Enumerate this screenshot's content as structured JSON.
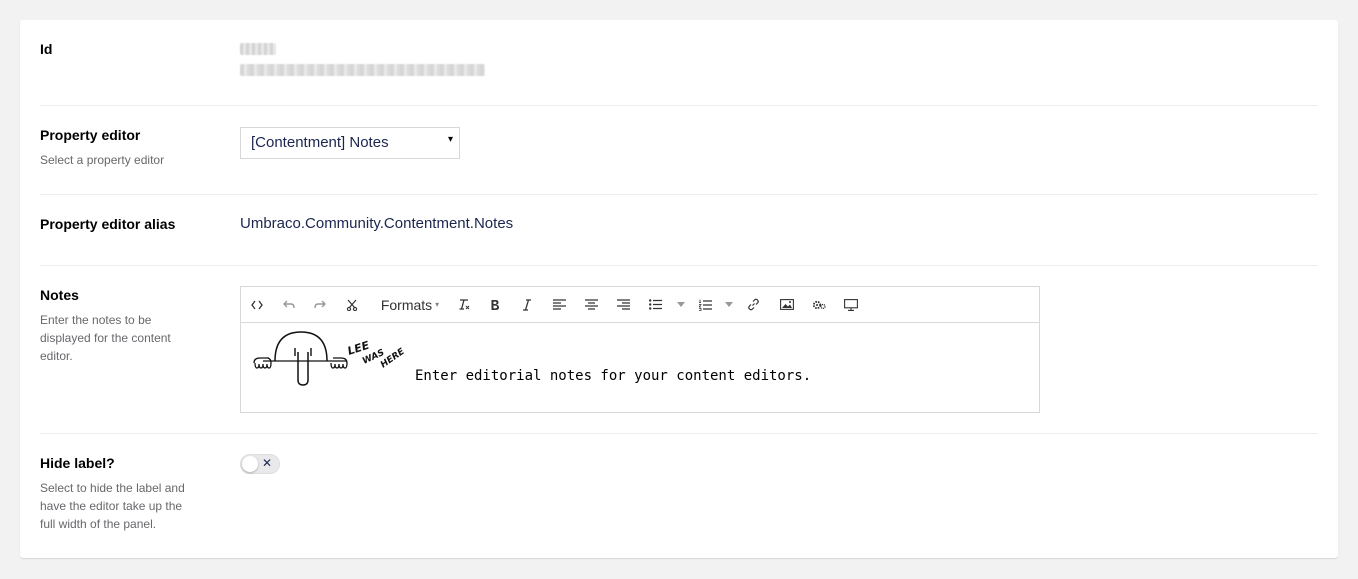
{
  "id_field": {
    "label": "Id",
    "value_line1": "1082",
    "value_line2": "8fe11d9b-e4f6-4bdb-8395-4bf6f8b22adf"
  },
  "property_editor": {
    "label": "Property editor",
    "description": "Select a property editor",
    "selected": "[Contentment] Notes",
    "caret": "▾"
  },
  "alias": {
    "label": "Property editor alias",
    "value": "Umbraco.Community.Contentment.Notes"
  },
  "notes": {
    "label": "Notes",
    "description": "Enter the notes to be displayed for the content editor.",
    "toolbar": {
      "formats_label": "Formats",
      "dropdown_caret": "▾",
      "buttons": [
        "source-code",
        "undo",
        "redo",
        "cut",
        "formats",
        "clear-formatting",
        "bold",
        "italic",
        "align-left",
        "align-center",
        "align-right",
        "bullet-list",
        "numbered-list",
        "link",
        "image",
        "macro",
        "embed"
      ]
    },
    "doodle_text": [
      "LEE",
      "WAS",
      "HERE"
    ],
    "content_text": "Enter editorial notes for your content editors."
  },
  "hide_label": {
    "label": "Hide label?",
    "description": "Select to hide the label and have the editor take up the full width of the panel.",
    "toggle_state": "off",
    "toggle_symbol": "✕"
  }
}
